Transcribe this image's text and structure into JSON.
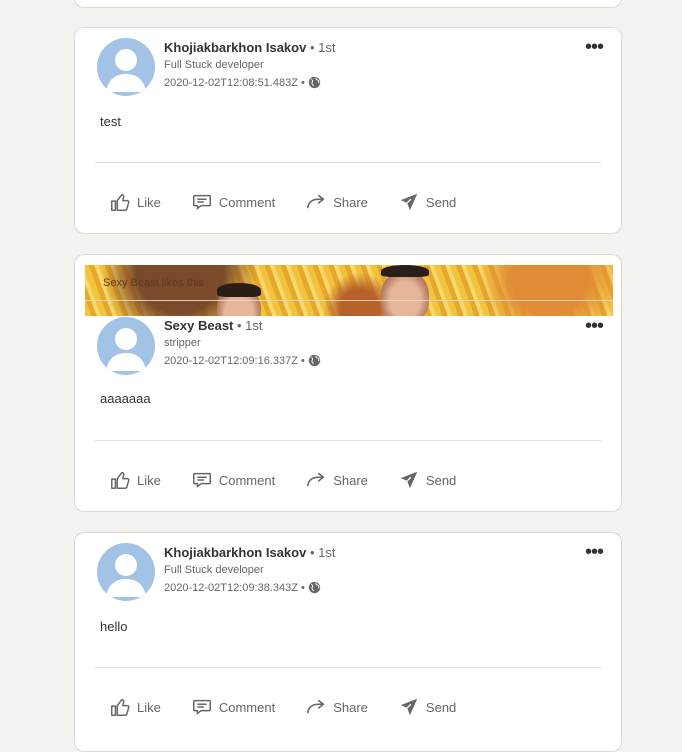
{
  "posts": [
    {
      "author": "Khojiakbarkhon Isakov",
      "degree": "• 1st",
      "headline": "Full Stuck developer",
      "timestamp": "2020-12-02T12:08:51.483Z •",
      "text": "test"
    },
    {
      "activity_user": "Sexy Beast",
      "activity_text": "likes this",
      "author": "Sexy Beast",
      "degree": "• 1st",
      "headline": "stripper",
      "timestamp": "2020-12-02T12:09:16.337Z •",
      "text": "aaaaaaa"
    },
    {
      "author": "Khojiakbarkhon Isakov",
      "degree": "• 1st",
      "headline": "Full Stuck developer",
      "timestamp": "2020-12-02T12:09:38.343Z •",
      "text": "hello"
    }
  ],
  "actions": {
    "like": "Like",
    "comment": "Comment",
    "share": "Share",
    "send": "Send"
  },
  "icons": {
    "more": "more-options-icon",
    "globe": "globe-icon",
    "like": "thumbs-up-icon",
    "comment": "comment-bubble-icon",
    "share": "share-arrow-icon",
    "send": "paper-plane-icon"
  },
  "colors": {
    "avatar_bg": "#a2c2e6",
    "page_bg": "#f3f2ef"
  }
}
